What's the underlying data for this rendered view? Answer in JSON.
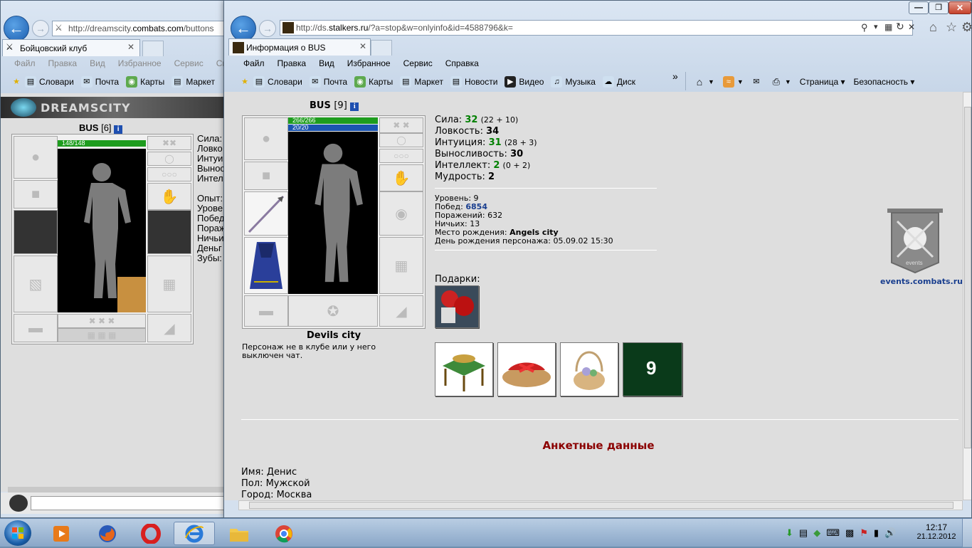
{
  "window1": {
    "url_prefix": "http://dreamscity.",
    "url_domain": "combats.com",
    "url_suffix": "/buttons",
    "tab_title": "Бойцовский клуб",
    "menu": [
      "Файл",
      "Правка",
      "Вид",
      "Избранное",
      "Сервис",
      "Спр"
    ],
    "favorites": [
      "Словари",
      "Почта",
      "Карты",
      "Маркет"
    ],
    "logo_text": "DREAMSCITY",
    "char_name": "BUS",
    "char_level": "[6]",
    "hp": "148/148",
    "stats": [
      "Сила:",
      "Ловко",
      "Интуи",
      "Вынос",
      "Интел"
    ],
    "info": [
      "Опыт:",
      "Урове",
      "Побед",
      "Пораж",
      "Ничьи",
      "Деньг",
      "Зубы:"
    ]
  },
  "window2": {
    "url_prefix": "http://ds.",
    "url_domain": "stalkers.ru",
    "url_suffix": "/?a=stop&w=onlyinfo&id=4588796&k=",
    "tab_title": "Информация о BUS",
    "menu": [
      "Файл",
      "Правка",
      "Вид",
      "Избранное",
      "Сервис",
      "Справка"
    ],
    "favorites": [
      "Словари",
      "Почта",
      "Карты",
      "Маркет",
      "Новости",
      "Видео",
      "Музыка",
      "Диск"
    ],
    "cmd": [
      "Страница ▾",
      "Безопасность ▾"
    ],
    "chevron": "»"
  },
  "profile": {
    "name": "BUS",
    "level": "[9]",
    "hp": "266/266",
    "mana": "20/20",
    "city": "Devils city",
    "status_note": "Персонаж не в клубе или у него выключен чат.",
    "stats": [
      {
        "label": "Сила: ",
        "value": "32",
        "green": true,
        "extra": "(22 + 10)"
      },
      {
        "label": "Ловкость: ",
        "value": "34",
        "green": false,
        "extra": ""
      },
      {
        "label": "Интуиция: ",
        "value": "31",
        "green": true,
        "extra": "(28 + 3)"
      },
      {
        "label": "Выносливость: ",
        "value": "30",
        "green": false,
        "extra": ""
      },
      {
        "label": "Интеллект: ",
        "value": "2",
        "green": true,
        "extra": "(0 + 2)"
      },
      {
        "label": "Мудрость: ",
        "value": "2",
        "green": false,
        "extra": ""
      }
    ],
    "level_label": "Уровень: ",
    "level_value": "9",
    "wins_label": "Побед: ",
    "wins_value": "6854",
    "losses_label": "Поражений: ",
    "losses_value": "632",
    "draws_label": "Ничьих: ",
    "draws_value": "13",
    "birthplace_label": "Место рождения: ",
    "birthplace_value": "Angels city",
    "birthday_label": "День рождения персонажа: ",
    "birthday_value": "05.09.02 15:30",
    "gifts_label": "Подарки:",
    "events_site": "events.combats.ru",
    "events_logo_text": "events",
    "questionnaire_title": "Анкетные данные",
    "name_label": "Имя: ",
    "name_value": "Денис",
    "sex_label": "Пол: ",
    "sex_value": "Мужской",
    "city_label": "Город: ",
    "city_value": "Москва",
    "gift_card_text": "9"
  },
  "taskbar": {
    "time": "12:17",
    "date": "21.12.2012"
  },
  "colors": {
    "hp": "#1e9c1e",
    "mana": "#1b55b0",
    "header_red": "#8b0000",
    "link_blue": "#1a3f8f"
  }
}
